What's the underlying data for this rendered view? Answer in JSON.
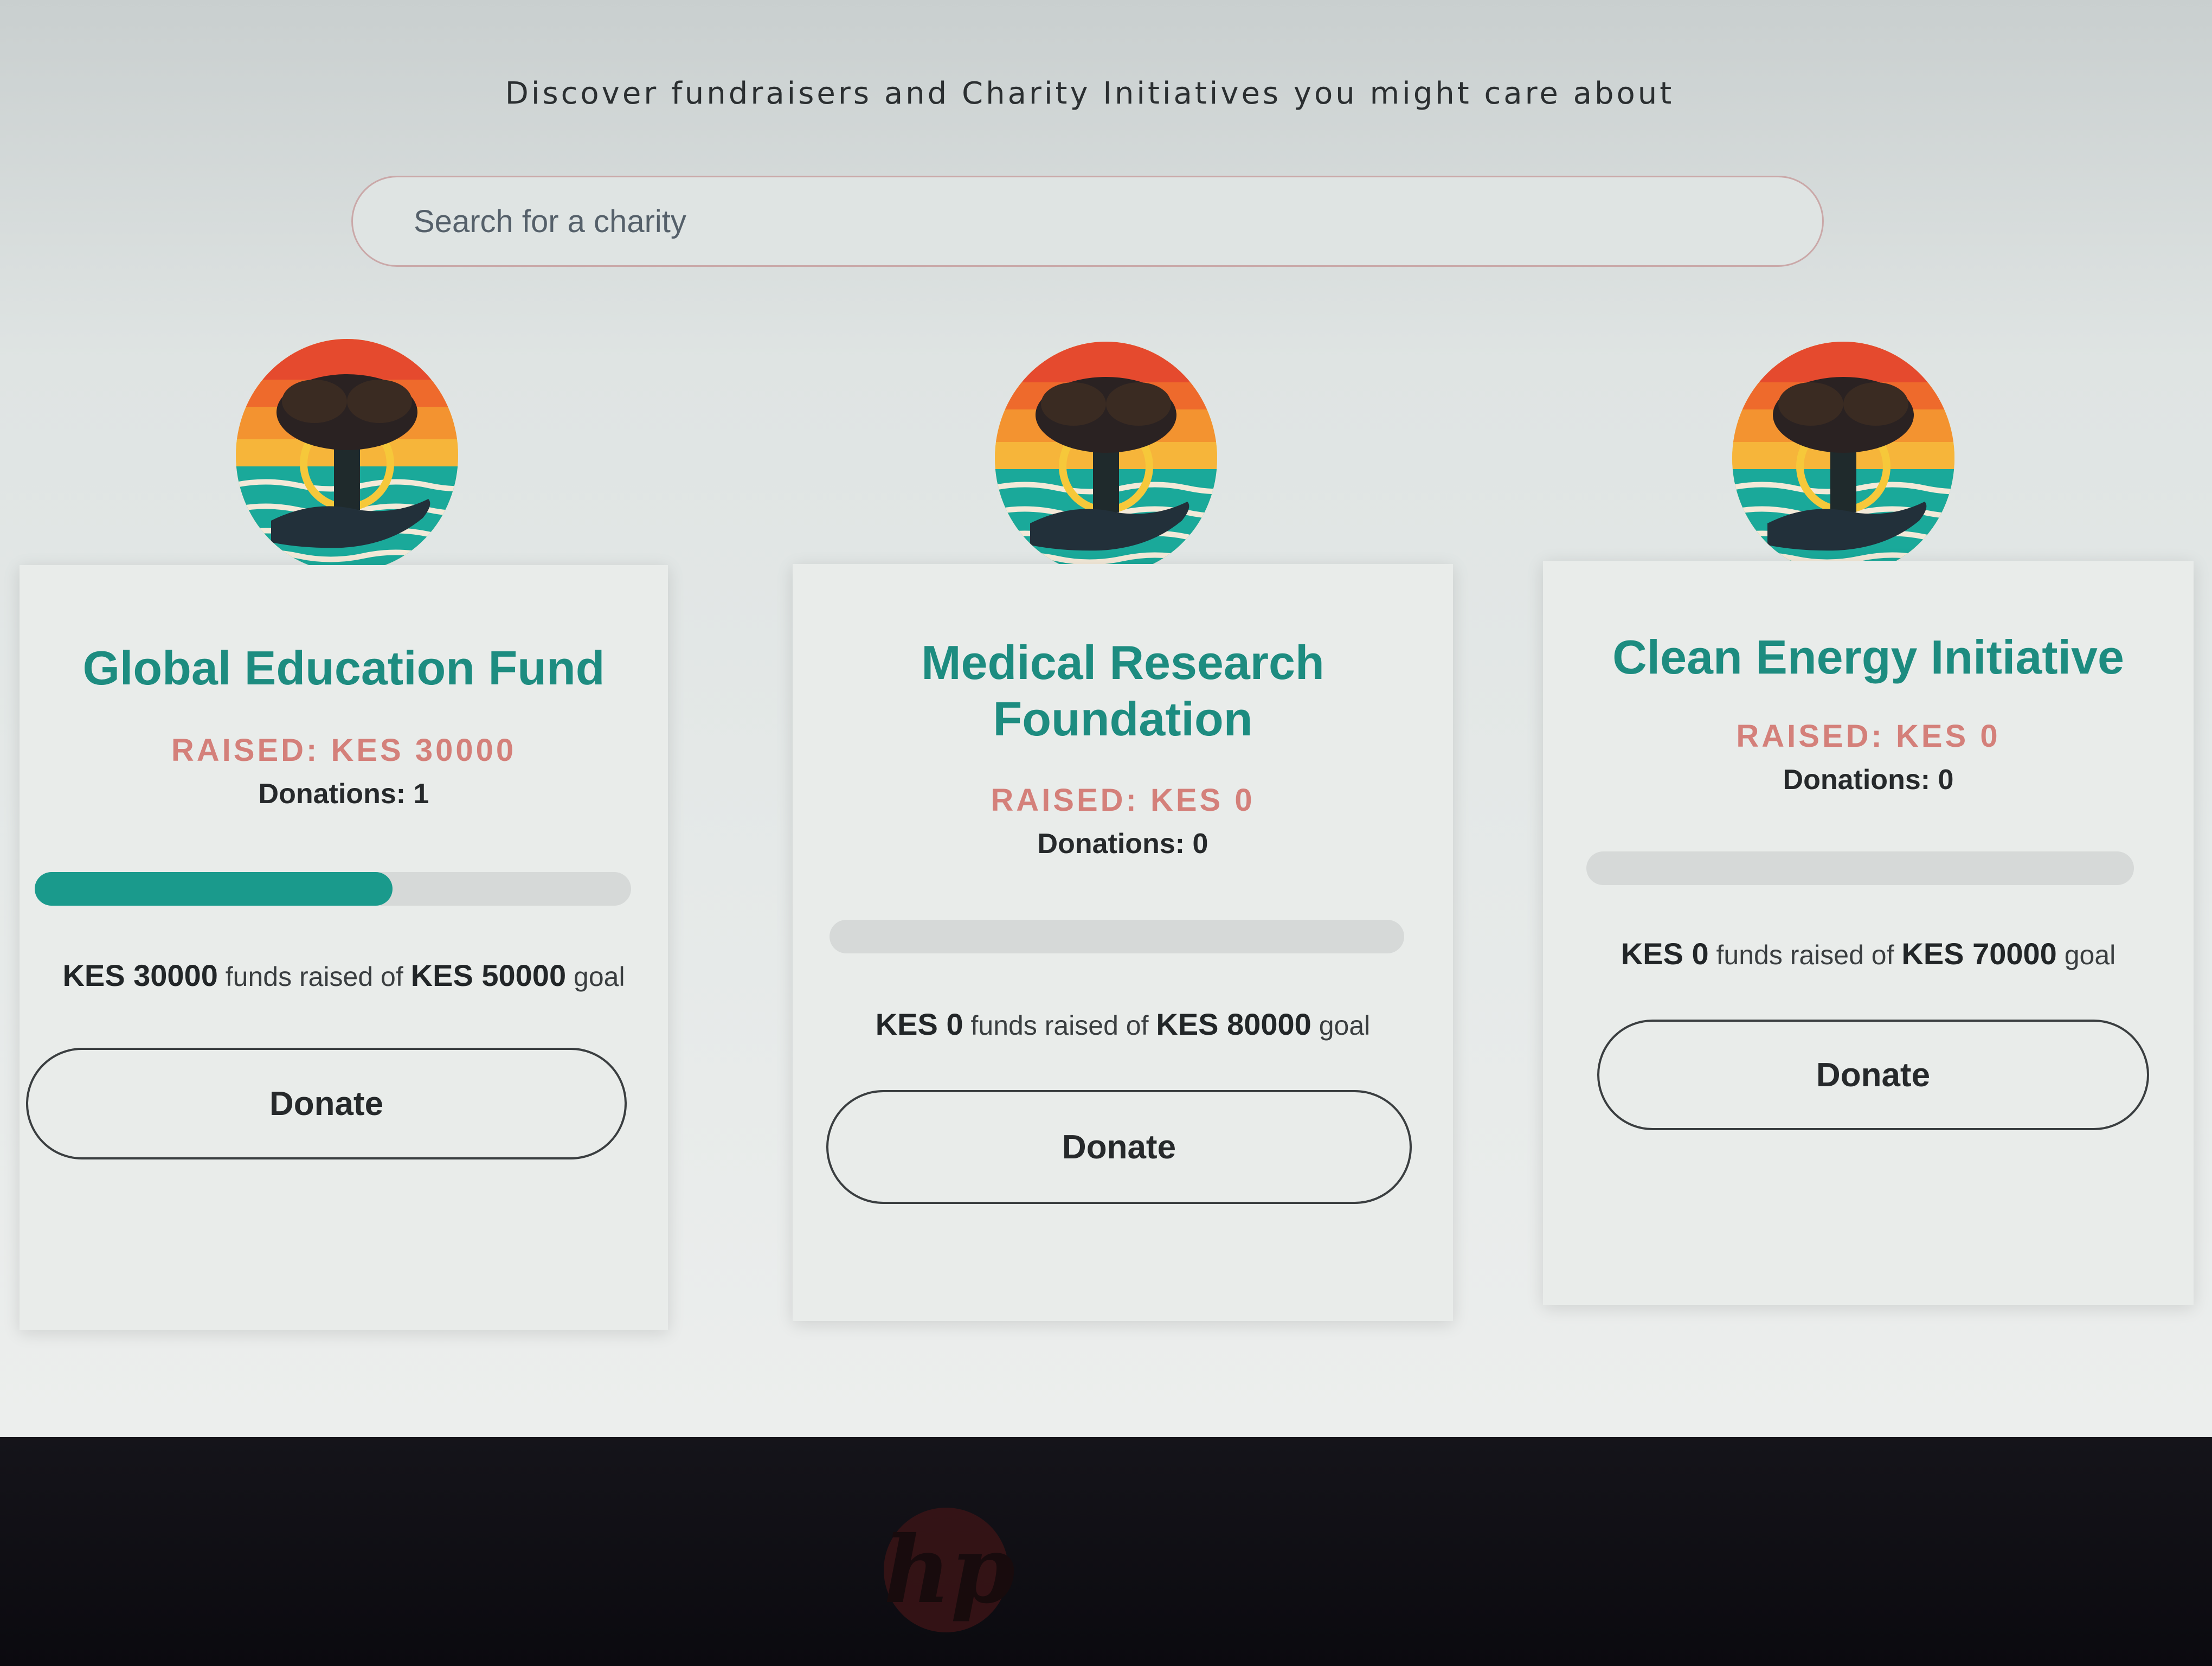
{
  "header": {
    "tagline": "Discover fundraisers and Charity Initiatives you might care about"
  },
  "search": {
    "placeholder": "Search for a charity"
  },
  "colors": {
    "title": "#1d8c80",
    "raised": "#d4807a",
    "progress_fill": "#1a9a8c",
    "progress_track": "#d6d9d8"
  },
  "charities": [
    {
      "title": "Global Education Fund",
      "raised_label": "RAISED: KES 30000",
      "donations_label": "Donations: 1",
      "progress_fraction": 0.6,
      "raised_amount": "KES 30000",
      "funds_raised_of": "funds raised of",
      "goal_amount": "KES 50000",
      "goal_word": "goal",
      "donate_label": "Donate",
      "logo_icon": "tree-sun-hand-logo-icon"
    },
    {
      "title": "Medical Research Foundation",
      "raised_label": "RAISED: KES 0",
      "donations_label": "Donations: 0",
      "progress_fraction": 0,
      "raised_amount": "KES 0",
      "funds_raised_of": "funds raised of",
      "goal_amount": "KES 80000",
      "goal_word": "goal",
      "donate_label": "Donate",
      "logo_icon": "tree-sun-hand-logo-icon"
    },
    {
      "title": "Clean Energy Initiative",
      "raised_label": "RAISED: KES 0",
      "donations_label": "Donations: 0",
      "progress_fraction": 0,
      "raised_amount": "KES 0",
      "funds_raised_of": "funds raised of",
      "goal_amount": "KES 70000",
      "goal_word": "goal",
      "donate_label": "Donate",
      "logo_icon": "tree-sun-hand-logo-icon"
    }
  ],
  "bezel": {
    "brand_logo_icon": "hp-logo-icon"
  }
}
